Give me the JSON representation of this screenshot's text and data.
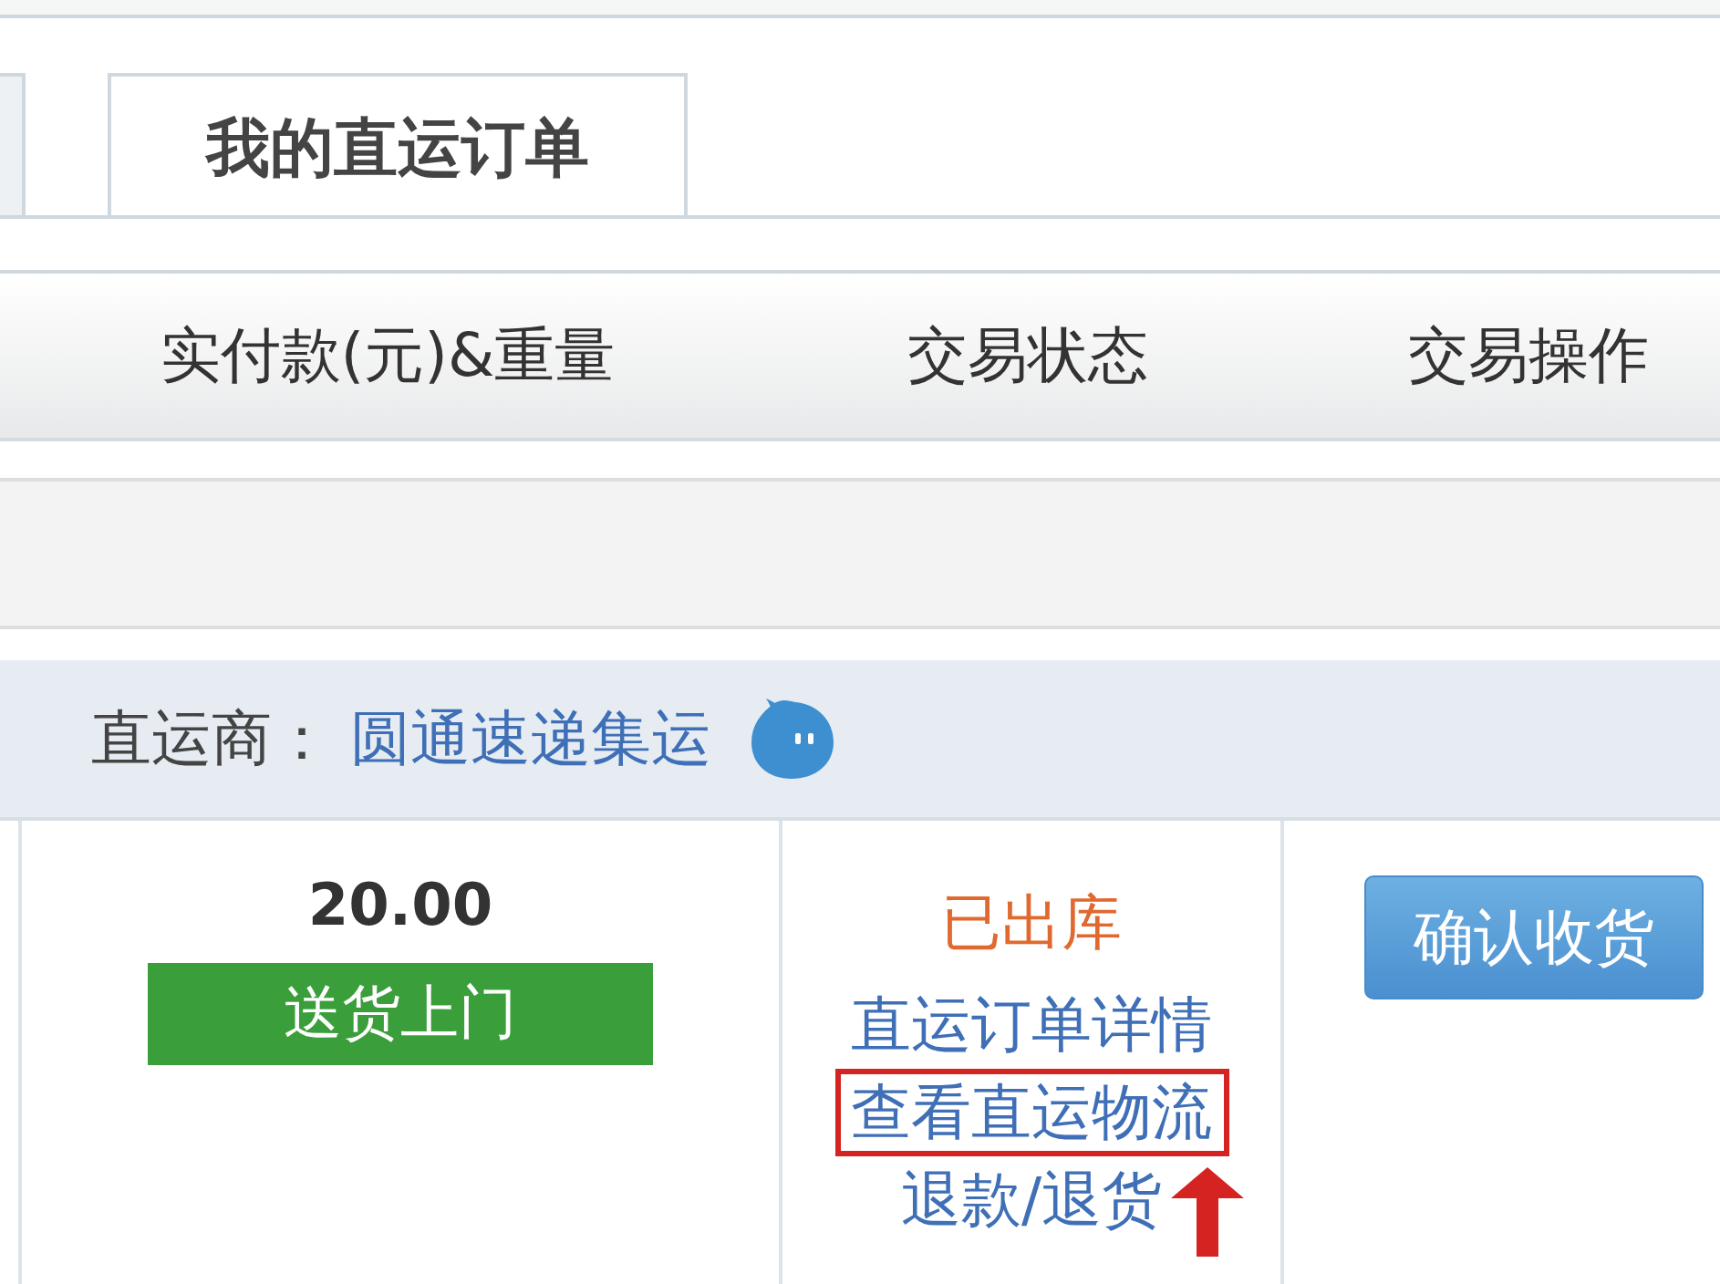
{
  "tabs": [
    {
      "selected": false
    },
    {
      "label": "我的直运订单",
      "selected": true
    }
  ],
  "table": {
    "columns": [
      "实付款(元)&重量",
      "交易状态",
      "交易操作"
    ],
    "group": {
      "provider_label": "直运商：",
      "provider_name": "圆通速递集运"
    },
    "rows": [
      {
        "amount": "20.00",
        "delivery_tag": "送货上门",
        "status": "已出库",
        "links": [
          {
            "label": "直运订单详情",
            "highlighted": false
          },
          {
            "label": "查看直运物流",
            "highlighted": true
          },
          {
            "label": "退款/退货",
            "highlighted": false
          }
        ],
        "action": "确认收货"
      }
    ]
  }
}
